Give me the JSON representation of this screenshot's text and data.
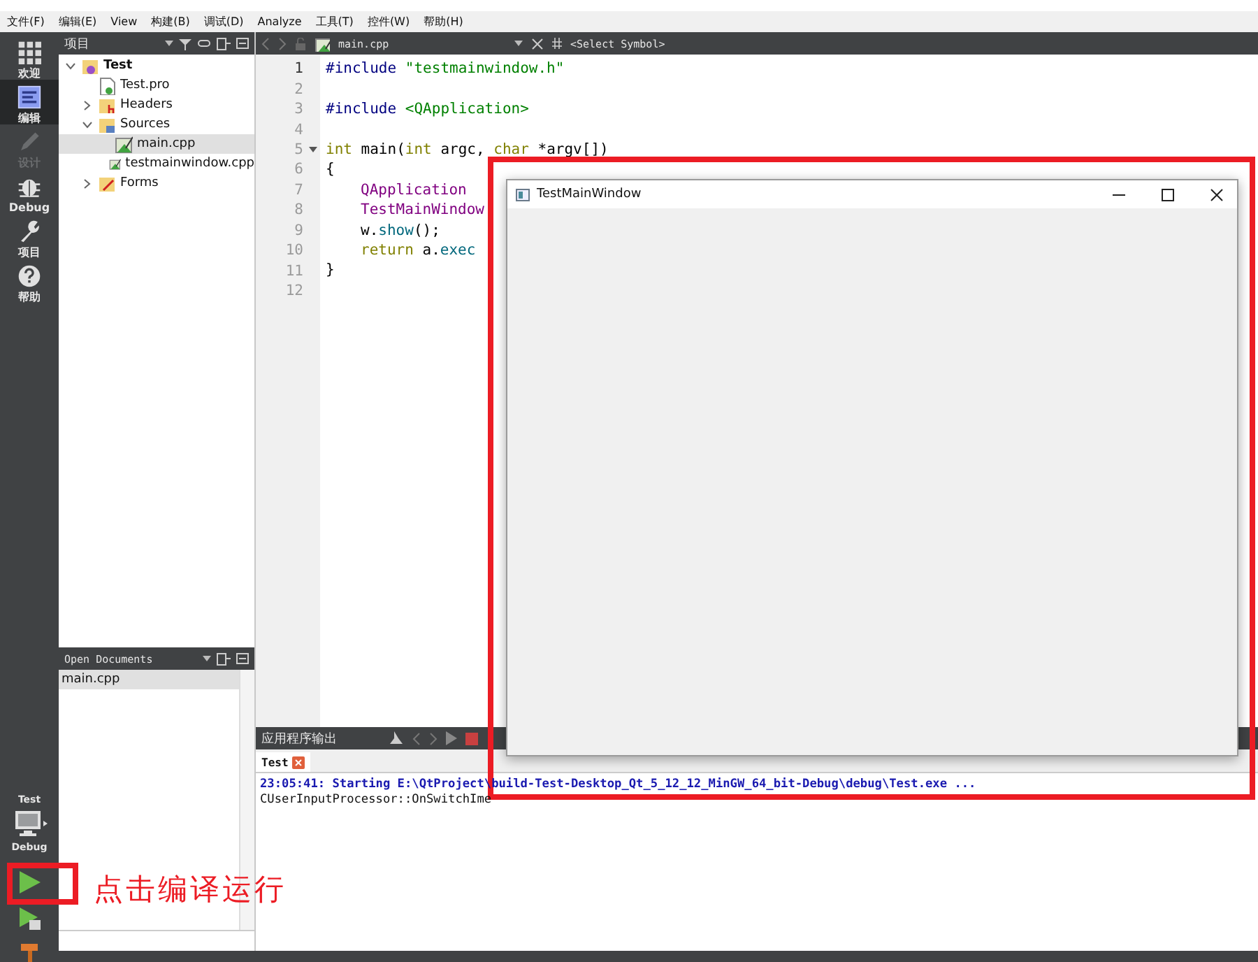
{
  "menu": [
    "文件(F)",
    "编辑(E)",
    "View",
    "构建(B)",
    "调试(D)",
    "Analyze",
    "工具(T)",
    "控件(W)",
    "帮助(H)"
  ],
  "modes": [
    {
      "label": "欢迎",
      "kind": "grid",
      "selected": false,
      "disabled": false
    },
    {
      "label": "编辑",
      "kind": "edit",
      "selected": true,
      "disabled": false
    },
    {
      "label": "设计",
      "kind": "pen",
      "selected": false,
      "disabled": true
    },
    {
      "label": "Debug",
      "kind": "bug",
      "selected": false,
      "disabled": false
    },
    {
      "label": "项目",
      "kind": "wrench",
      "selected": false,
      "disabled": false
    },
    {
      "label": "帮助",
      "kind": "help",
      "selected": false,
      "disabled": false
    }
  ],
  "kit": {
    "project": "Test",
    "build": "Debug"
  },
  "project_panel": {
    "title": "项目",
    "tree": [
      {
        "label": "Test",
        "kind": "project",
        "expanded": true,
        "selected": false,
        "children": [
          {
            "label": "Test.pro",
            "kind": "pro",
            "selected": false
          },
          {
            "label": "Headers",
            "kind": "headers",
            "expanded": false,
            "selected": false
          },
          {
            "label": "Sources",
            "kind": "sources",
            "expanded": true,
            "selected": false,
            "children": [
              {
                "label": "main.cpp",
                "kind": "cpp",
                "selected": true
              },
              {
                "label": "testmainwindow.cpp",
                "kind": "cpp",
                "selected": false
              }
            ]
          },
          {
            "label": "Forms",
            "kind": "forms",
            "expanded": false,
            "selected": false
          }
        ]
      }
    ]
  },
  "open_documents": {
    "title": "Open Documents",
    "items": [
      {
        "label": "main.cpp",
        "selected": true
      }
    ]
  },
  "editor": {
    "file": "main.cpp",
    "symbol": "<Select Symbol>",
    "lines": [
      {
        "number": "1",
        "foldable": false,
        "indented": false,
        "code": [
          {
            "text": "#include ",
            "kind": "directive"
          },
          {
            "text": "\"testmainwindow.h\"",
            "kind": "string"
          }
        ]
      },
      {
        "number": "2",
        "foldable": false
      },
      {
        "number": "3",
        "foldable": false,
        "indented": false,
        "code": [
          {
            "text": "#include ",
            "kind": "directive"
          },
          {
            "text": "<QApplication>",
            "kind": "string"
          }
        ]
      },
      {
        "number": "4",
        "foldable": false
      },
      {
        "number": "5",
        "foldable": true,
        "indented": false,
        "code": [
          {
            "text": "int",
            "kind": "keyword"
          },
          {
            "text": " main(",
            "kind": "plain"
          },
          {
            "text": "int",
            "kind": "keyword"
          },
          {
            "text": " argc, ",
            "kind": "plain"
          },
          {
            "text": "char",
            "kind": "keyword"
          },
          {
            "text": " *argv[])",
            "kind": "plain"
          }
        ]
      },
      {
        "number": "6",
        "foldable": false,
        "indented": false,
        "code": [
          {
            "text": "{",
            "kind": "plain"
          }
        ]
      },
      {
        "number": "7",
        "foldable": false,
        "indented": true,
        "code": [
          {
            "text": "QApplication",
            "kind": "type"
          }
        ]
      },
      {
        "number": "8",
        "foldable": false,
        "indented": true,
        "code": [
          {
            "text": "TestMainWindow",
            "kind": "type"
          }
        ]
      },
      {
        "number": "9",
        "foldable": false,
        "indented": true,
        "code": [
          {
            "text": "w.",
            "kind": "plain"
          },
          {
            "text": "show",
            "kind": "call"
          },
          {
            "text": "();",
            "kind": "plain"
          }
        ]
      },
      {
        "number": "10",
        "foldable": false,
        "indented": true,
        "code": [
          {
            "text": "return",
            "kind": "keyword"
          },
          {
            "text": " a.",
            "kind": "plain"
          },
          {
            "text": "exec",
            "kind": "call"
          }
        ]
      },
      {
        "number": "11",
        "foldable": false,
        "indented": false,
        "code": [
          {
            "text": "}",
            "kind": "plain"
          }
        ]
      },
      {
        "number": "12",
        "foldable": false
      }
    ]
  },
  "output": {
    "title": "应用程序输出",
    "tabs": [
      {
        "label": "Test",
        "selected": true
      }
    ],
    "lines": [
      {
        "text": "23:05:41: Starting E:\\QtProject\\build-Test-Desktop_Qt_5_12_12_MinGW_64_bit-Debug\\debug\\Test.exe ...",
        "kind": "status"
      },
      {
        "text": "CUserInputProcessor::OnSwitchIme",
        "kind": "plain"
      }
    ]
  },
  "app_window": {
    "title": "TestMainWindow"
  },
  "annotation": {
    "text": "点击编译运行"
  }
}
